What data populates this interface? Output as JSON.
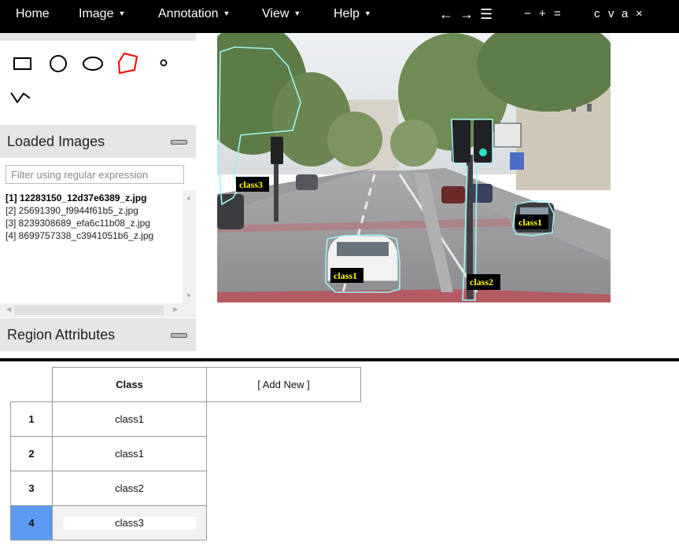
{
  "menu": {
    "home": "Home",
    "image": "Image",
    "annotation": "Annotation",
    "view": "View",
    "help": "Help",
    "caret": "▼",
    "prev": "←",
    "next": "→",
    "list": "☰",
    "zoom_out": "−",
    "zoom_in": "+",
    "zoom_reset": "=",
    "copy": "c",
    "paste": "v",
    "select_all": "a",
    "delete": "×"
  },
  "shape_tools": [
    {
      "name": "rectangle",
      "icon": "rect-icon"
    },
    {
      "name": "circle",
      "icon": "circle-icon"
    },
    {
      "name": "ellipse",
      "icon": "ellipse-icon"
    },
    {
      "name": "polygon",
      "icon": "polygon-icon",
      "active": true,
      "color": "#ff0000"
    },
    {
      "name": "point",
      "icon": "point-icon"
    },
    {
      "name": "polyline",
      "icon": "polyline-icon"
    }
  ],
  "loaded_images": {
    "title": "Loaded Images",
    "filter_placeholder": "Filter using regular expression",
    "items": [
      "[1] 12283150_12d37e6389_z.jpg",
      "[2] 25691390_f9944f61b5_z.jpg",
      "[3] 8239308689_efa6c11b08_z.jpg",
      "[4] 8699757338_c3941051b6_z.jpg"
    ],
    "active_index": 0
  },
  "region_attributes": {
    "title": "Region Attributes"
  },
  "regions": [
    {
      "label": "class3"
    },
    {
      "label": "class1"
    },
    {
      "label": "class1"
    },
    {
      "label": "class2"
    }
  ],
  "attr_table": {
    "header_class": "Class",
    "add_new": "[ Add New ]",
    "rows": [
      {
        "id": "1",
        "value": "class1"
      },
      {
        "id": "2",
        "value": "class1"
      },
      {
        "id": "3",
        "value": "class2"
      },
      {
        "id": "4",
        "value": "class3"
      }
    ],
    "selected_row": 3
  },
  "colors": {
    "region_outline": "#9ef3f3",
    "label_bg": "#000000",
    "label_text": "#ffff00",
    "selected_row": "#5b9bf3",
    "active_tool": "#ff0000"
  }
}
